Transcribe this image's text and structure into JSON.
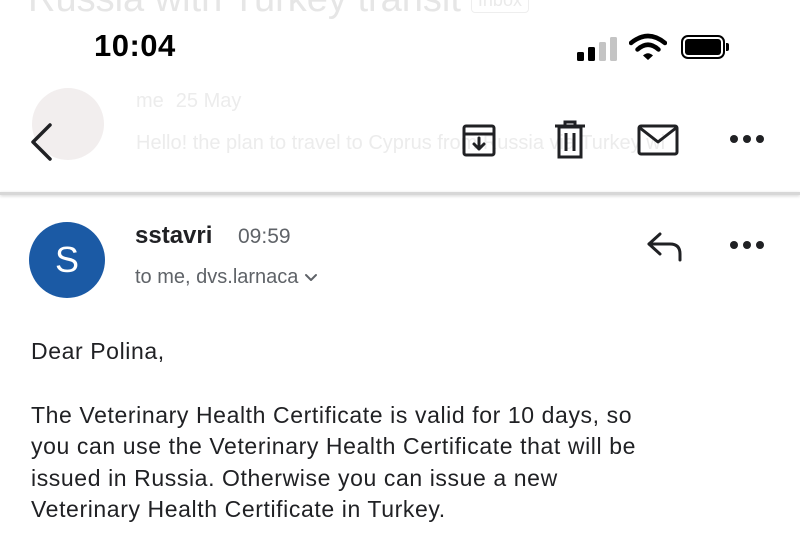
{
  "background": {
    "subject": "Russia with Turkey transit",
    "badge": "Inbox",
    "sender": "me",
    "date": "25 May",
    "snippet": "Hello! the plan to travel to Cyprus from Russia via Turkey wi"
  },
  "status_bar": {
    "time": "10:04",
    "icons": [
      "cellular-signal-icon",
      "wifi-icon",
      "battery-icon"
    ]
  },
  "toolbar": {
    "icons": [
      "back-icon",
      "archive-icon",
      "trash-icon",
      "mail-icon",
      "more-icon"
    ]
  },
  "message": {
    "avatar_letter": "S",
    "avatar_color": "#1b5aa5",
    "sender": "sstavri",
    "time": "09:59",
    "recipients": "to me, dvs.larnaca",
    "greeting": "Dear Polina,",
    "paragraph_lines": [
      "The Veterinary Health Certificate is valid for 10 days, so",
      "you can use the Veterinary Health Certificate that will be",
      "issued in Russia. Otherwise you can issue a new",
      "Veterinary Health Certificate in Turkey."
    ]
  }
}
